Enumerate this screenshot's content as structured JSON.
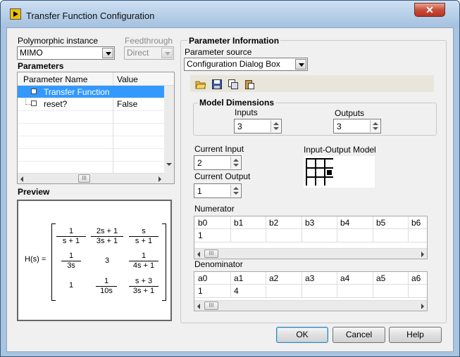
{
  "window": {
    "title": "Transfer Function Configuration",
    "close_glyph": "✕"
  },
  "left": {
    "polymorphic_label": "Polymorphic instance",
    "polymorphic_value": "MIMO",
    "feedthrough_label": "Feedthrough",
    "feedthrough_value": "Direct",
    "parameters_label": "Parameters",
    "param_headers": [
      "Parameter Name",
      "Value"
    ],
    "param_rows": [
      {
        "name": "Transfer Function",
        "value": "",
        "selected": true
      },
      {
        "name": "reset?",
        "value": "False",
        "selected": false
      }
    ],
    "preview_label": "Preview"
  },
  "preview": {
    "lhs": "H(s) =",
    "cells": [
      {
        "num": "1",
        "den": "s + 1"
      },
      {
        "num": "2s + 1",
        "den": "3s + 1"
      },
      {
        "num": "s",
        "den": "s + 1"
      },
      {
        "num": "1",
        "den": "3s"
      },
      {
        "plain": "3"
      },
      {
        "num": "1",
        "den": "4s + 1"
      },
      {
        "plain": "1"
      },
      {
        "num": "1",
        "den": "10s"
      },
      {
        "num": "s + 3",
        "den": "3s + 1"
      }
    ]
  },
  "right": {
    "param_info_label": "Parameter Information",
    "param_source_label": "Parameter source",
    "param_source_value": "Configuration Dialog Box",
    "toolbar_icons": [
      "open-folder-icon",
      "save-icon",
      "copy-icon",
      "paste-icon"
    ],
    "model_dims_label": "Model Dimensions",
    "inputs_label": "Inputs",
    "inputs_value": "3",
    "outputs_label": "Outputs",
    "outputs_value": "3",
    "current_input_label": "Current Input",
    "current_input_value": "2",
    "current_output_label": "Current Output",
    "current_output_value": "1",
    "io_model_label": "Input-Output Model",
    "io_model_selected": {
      "row": 2,
      "col": 3
    },
    "numerator_label": "Numerator",
    "numerator_headers": [
      "b0",
      "b1",
      "b2",
      "b3",
      "b4",
      "b5",
      "b6"
    ],
    "numerator_values": [
      "1",
      "",
      "",
      "",
      "",
      "",
      ""
    ],
    "denominator_label": "Denominator",
    "denominator_headers": [
      "a0",
      "a1",
      "a2",
      "a3",
      "a4",
      "a5",
      "a6"
    ],
    "denominator_values": [
      "1",
      "4",
      "",
      "",
      "",
      "",
      ""
    ]
  },
  "buttons": {
    "ok": "OK",
    "cancel": "Cancel",
    "help": "Help"
  },
  "scroll_thumb_glyph": "III"
}
